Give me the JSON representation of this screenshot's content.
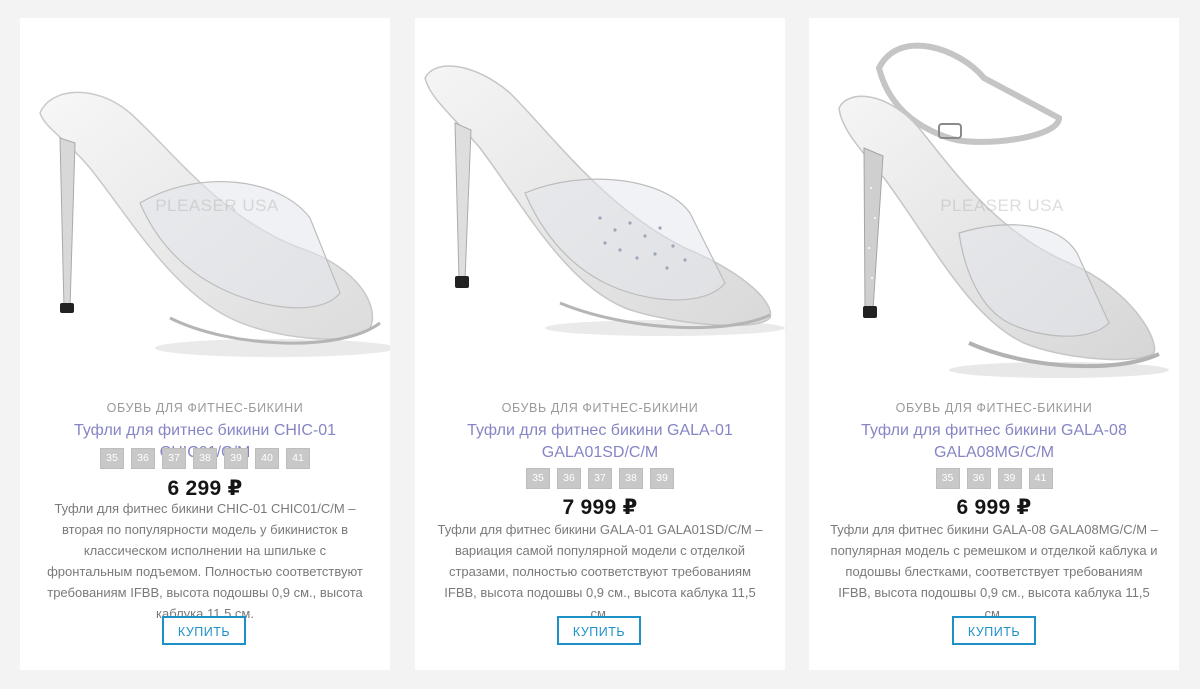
{
  "products": [
    {
      "category": "ОБУВЬ ДЛЯ ФИТНЕС-БИКИНИ",
      "title": "Туфли для фитнес бикини CHIC-01 CHIC01/C/M",
      "sizes": [
        "35",
        "36",
        "37",
        "38",
        "39",
        "40",
        "41"
      ],
      "price": "6 299 ₽",
      "description": "Туфли для фитнес бикини CHIC-01 CHIC01/C/M – вторая по популярности модель у бикинисток в классическом исполнении на шпильке с фронтальным подъемом. Полностью соответствуют требованиям IFBB, высота подошвы 0,9 см., высота каблука 11,5 см.",
      "buy_label": "КУПИТЬ",
      "watermark": "PLEASER USA",
      "image_icon": "clear-stiletto-mule-image"
    },
    {
      "category": "ОБУВЬ ДЛЯ ФИТНЕС-БИКИНИ",
      "title": "Туфли для фитнес бикини GALA-01 GALA01SD/C/M",
      "sizes": [
        "35",
        "36",
        "37",
        "38",
        "39"
      ],
      "price": "7 999 ₽",
      "description": "Туфли для фитнес бикини GALA-01 GALA01SD/C/M – вариация самой популярной модели с отделкой стразами, полностью соответствуют требованиям IFBB, высота подошвы 0,9 см., высота каблука 11,5 см.",
      "buy_label": "КУПИТЬ",
      "watermark": "",
      "image_icon": "rhinestone-mule-image"
    },
    {
      "category": "ОБУВЬ ДЛЯ ФИТНЕС-БИКИНИ",
      "title": "Туфли для фитнес бикини GALA-08 GALA08MG/C/M",
      "sizes": [
        "35",
        "36",
        "39",
        "41"
      ],
      "price": "6 999 ₽",
      "description": "Туфли для фитнес бикини GALA-08 GALA08MG/C/M  – популярная модель с ремешком и отделкой каблука и подошвы блестками, соответствует требованиям IFBB, высота подошвы 0,9 см., высота каблука 11,5 см.",
      "buy_label": "КУПИТЬ",
      "watermark": "PLEASER USA",
      "image_icon": "glitter-ankle-strap-sandal-image"
    }
  ],
  "colors": {
    "page_bg": "#f3f3f3",
    "card_bg": "#ffffff",
    "title_link": "#8585c6",
    "size_badge": "#c8c8c8",
    "button_accent": "#1e90c8",
    "price": "#151515"
  }
}
